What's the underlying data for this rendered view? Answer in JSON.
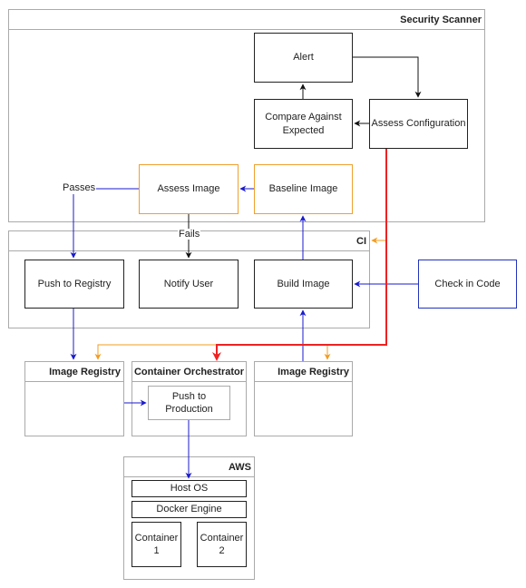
{
  "groups": {
    "security_scanner": "Security Scanner",
    "ci": "CI",
    "image_registry_left": "Image Registry",
    "container_orchestrator": "Container Orchestrator",
    "image_registry_right": "Image Registry",
    "aws": "AWS"
  },
  "nodes": {
    "alert": "Alert",
    "compare_line1": "Compare Against",
    "compare_line2": "Expected",
    "assess_configuration": "Assess Configuration",
    "assess_image": "Assess Image",
    "baseline_image": "Baseline Image",
    "push_to_registry": "Push to Registry",
    "notify_user": "Notify User",
    "build_image": "Build Image",
    "check_in_code": "Check in Code",
    "push_prod_line1": "Push to",
    "push_prod_line2": "Production",
    "host_os": "Host OS",
    "docker_engine": "Docker Engine",
    "container1_line1": "Container",
    "container1_line2": "1",
    "container2_line1": "Container",
    "container2_line2": "2"
  },
  "edge_labels": {
    "passes": "Passes",
    "fails": "Fails"
  },
  "colors": {
    "black_edge": "#111111",
    "blue_edge": "#1a1acc",
    "orange_edge": "#f39c1f",
    "red_edge": "#ee2222",
    "orange_box": "#f0a030",
    "blue_box": "#2233bb"
  }
}
